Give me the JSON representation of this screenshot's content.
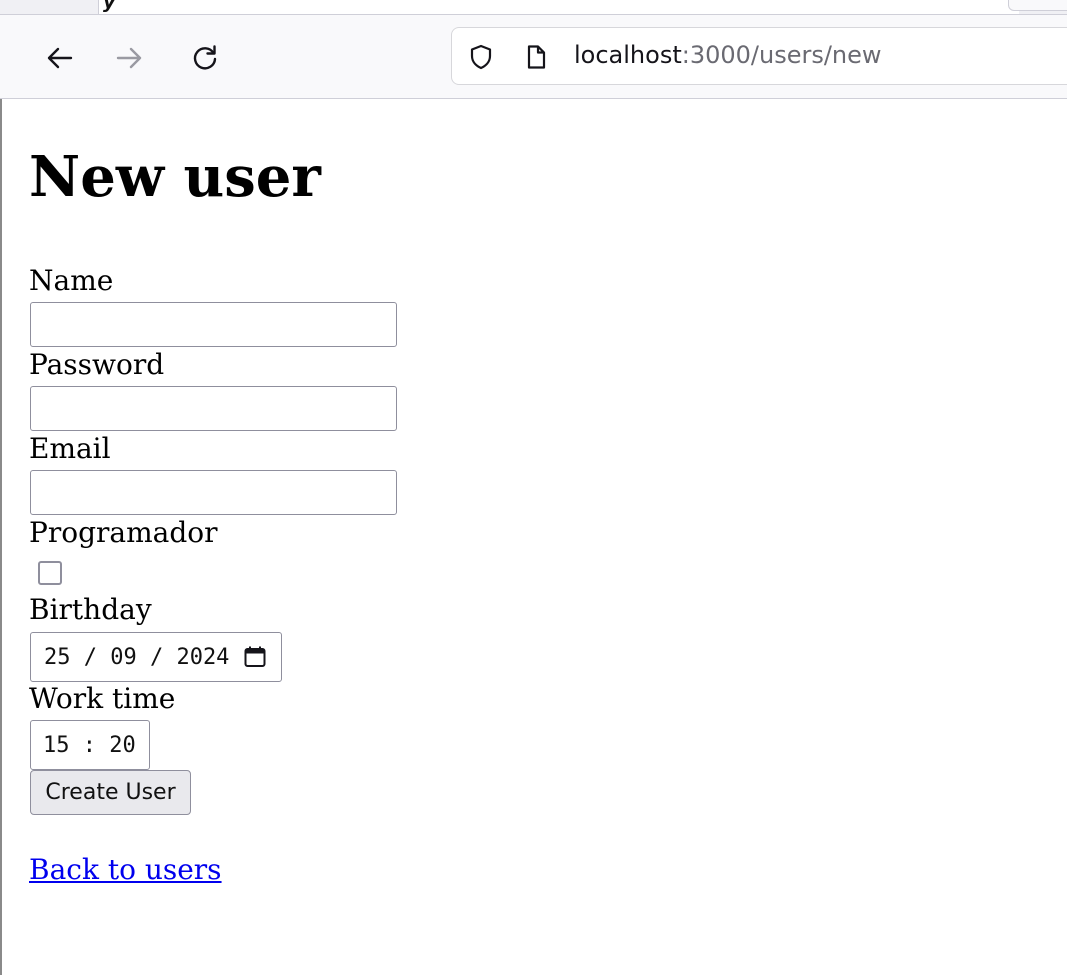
{
  "browser": {
    "tab_title_fragment": "y",
    "back_icon": "arrow-left-icon",
    "forward_icon": "arrow-right-icon",
    "reload_icon": "reload-icon",
    "security_icon": "shield-icon",
    "page_icon": "page-icon",
    "url_host": "localhost",
    "url_rest": ":3000/users/new"
  },
  "page": {
    "title": "New user",
    "fields": {
      "name_label": "Name",
      "name_value": "",
      "password_label": "Password",
      "password_value": "",
      "email_label": "Email",
      "email_value": "",
      "programador_label": "Programador",
      "programador_checked": false,
      "birthday_label": "Birthday",
      "birthday_value": "25 / 09 / 2024",
      "birthday_icon": "calendar-icon",
      "work_time_label": "Work time",
      "work_time_value": "15 : 20"
    },
    "submit_label": "Create User",
    "back_link": "Back to users"
  },
  "colors": {
    "link": "#0000ee",
    "toolbar_bg": "#f9f9fb",
    "input_border": "#8f8f9d",
    "button_bg": "#e9e9ed"
  }
}
